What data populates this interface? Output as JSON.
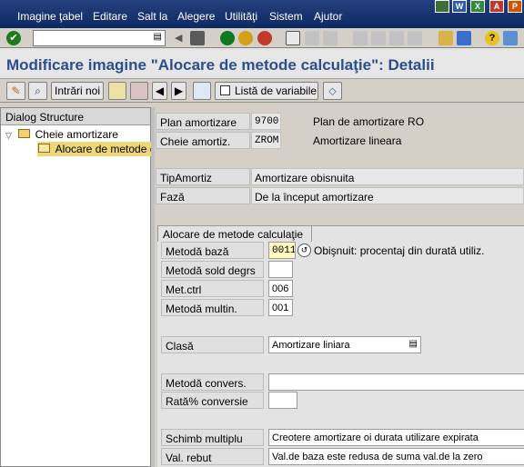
{
  "menu": {
    "items": [
      "Imagine ţabel",
      "Editare",
      "Salt la",
      "Alegere",
      "Utilităţi",
      "Sistem",
      "Ajutor"
    ]
  },
  "window_icons": [
    "W",
    "X",
    "A",
    "P"
  ],
  "title": "Modificare imagine \"Alocare de metode calculaţie\": Detalii",
  "toolbar2": {
    "new_entries": "Intrări noi",
    "variable_list": "Listă de variabile"
  },
  "tree": {
    "header": "Dialog Structure",
    "items": [
      "Cheie amortizare",
      "Alocare de metode c"
    ]
  },
  "header_fields": [
    {
      "label": "Plan amortizare",
      "value": "9700",
      "desc": "Plan de amortizare RO"
    },
    {
      "label": "Cheie amortiz.",
      "value": "ZROM",
      "desc": "Amortizare lineara"
    }
  ],
  "type_fields": [
    {
      "label": "TipAmortiz",
      "value": "Amortizare obisnuita"
    },
    {
      "label": "Fază",
      "value": "De la început amortizare"
    }
  ],
  "group": {
    "title": "Alocare de metode calculaţie",
    "rows": [
      {
        "label": "Metodă bază",
        "value": "0011",
        "desc": "Obişnuit: procentaj din durată utiliz."
      },
      {
        "label": "Metodă sold degrs",
        "value": ""
      },
      {
        "label": "Met.ctrl",
        "value": "006"
      },
      {
        "label": "Metodă multin.",
        "value": "001"
      },
      {
        "label": "Clasă",
        "value": "Amortizare liniara"
      },
      {
        "label": "Metodă convers.",
        "value": ""
      },
      {
        "label": "Rată% conversie",
        "value": ""
      },
      {
        "label": "Schimb multiplu",
        "value": "Creotere amortizare oi durata utilizare expirata"
      },
      {
        "label": "Val. rebut",
        "value": "Val.de baza este redusa de suma val.de la zero"
      }
    ]
  }
}
